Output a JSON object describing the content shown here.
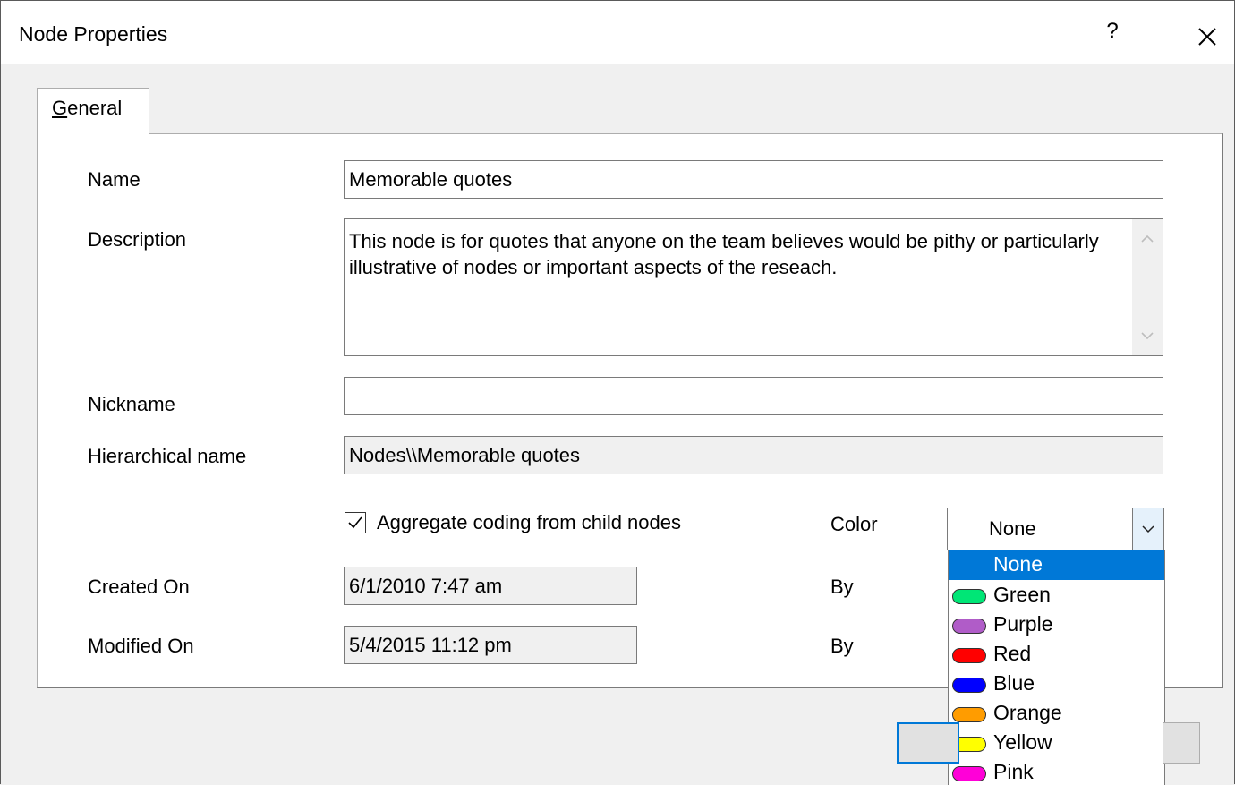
{
  "window": {
    "title": "Node Properties",
    "help_label": "?"
  },
  "tabs": [
    {
      "label": "General",
      "underline": "G",
      "rest": "eneral"
    }
  ],
  "form": {
    "name_label": "Name",
    "name_value": "Memorable quotes",
    "description_label": "Description",
    "description_value": "This node is for quotes that anyone on the team believes would be pithy or particularly illustrative of nodes or important aspects of the reseach.",
    "nickname_label": "Nickname",
    "nickname_value": "",
    "hierarchical_label": "Hierarchical name",
    "hierarchical_value": "Nodes\\\\Memorable quotes",
    "aggregate_label": "Aggregate coding from child nodes",
    "aggregate_checked": true,
    "color_label": "Color",
    "color_value": "None",
    "created_label": "Created On",
    "created_value": "6/1/2010 7:47 am",
    "created_by_label": "By",
    "modified_label": "Modified On",
    "modified_value": "5/4/2015 11:12 pm",
    "modified_by_label": "By"
  },
  "color_options": [
    {
      "label": "None",
      "color": null,
      "selected": true
    },
    {
      "label": "Green",
      "color": "#00e676"
    },
    {
      "label": "Purple",
      "color": "#b05cc8"
    },
    {
      "label": "Red",
      "color": "#ff0000"
    },
    {
      "label": "Blue",
      "color": "#0000ff"
    },
    {
      "label": "Orange",
      "color": "#ff9c00"
    },
    {
      "label": "Yellow",
      "color": "#ffff00"
    },
    {
      "label": "Pink",
      "color": "#ff00d8"
    }
  ],
  "theme": {
    "accent": "#0078d7"
  }
}
